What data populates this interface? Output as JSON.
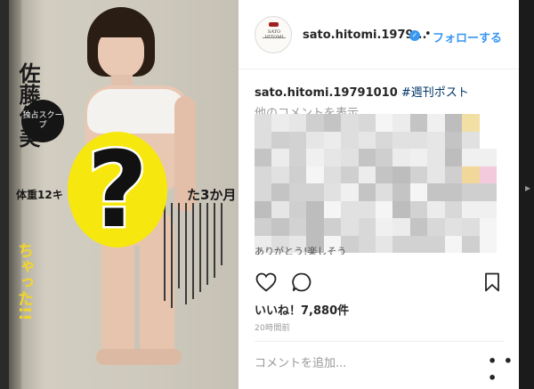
{
  "photo": {
    "headline_name": "佐藤仁美",
    "scoop_badge": "独占スクープ",
    "weight_line": "体重12キ",
    "duration_text": "た3か月",
    "yellow_vertical": "ちゃった!!",
    "question_mark": "?"
  },
  "post": {
    "avatar_text_top": "SATO HITOMI",
    "avatar_text_bottom": "",
    "username": "sato.hitomi.19791010",
    "username_truncated": "sato.hitomi.1979...",
    "verified_icon": "verified-badge-icon",
    "separator": "•",
    "follow_label": "フォローする",
    "caption_user": "sato.hitomi.19791010",
    "caption_hashtag": "#週刊ポスト",
    "more_comments_label": "他のコメントを表示",
    "cut_off_text": "ありがとう!楽しそう",
    "likes": "いいね！7,880件",
    "timestamp": "20時間前",
    "comment_placeholder": "コメントを追加...",
    "more_options_label": "• • •",
    "icons": [
      "heart-icon",
      "comment-icon",
      "bookmark-icon",
      "more-options-icon"
    ]
  },
  "viewer": {
    "next_arrow": "▸"
  },
  "colors": {
    "link_blue": "#3897f0",
    "hashtag_blue": "#003569",
    "muted_gray": "#999999",
    "text_dark": "#262626",
    "highlight_yellow": "#f6e70f"
  }
}
